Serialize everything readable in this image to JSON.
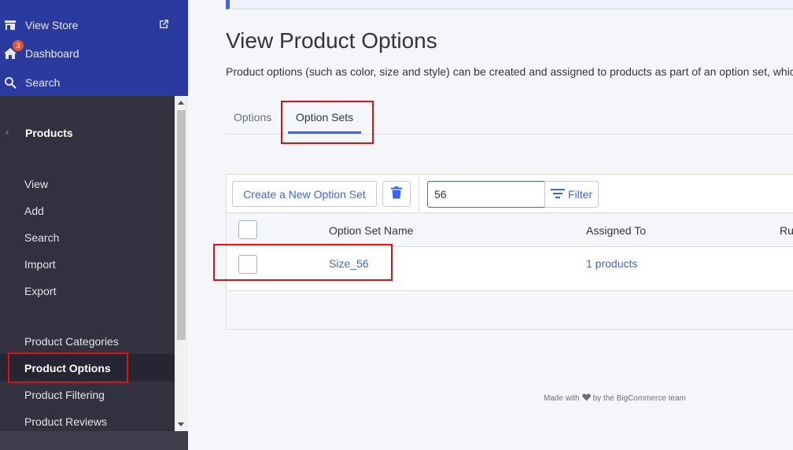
{
  "sidebar": {
    "top": {
      "view_store": "View Store",
      "dashboard": "Dashboard",
      "dashboard_badge": "3",
      "search": "Search"
    },
    "section_title": "Products",
    "items": [
      {
        "label": "View"
      },
      {
        "label": "Add"
      },
      {
        "label": "Search"
      },
      {
        "label": "Import"
      },
      {
        "label": "Export"
      },
      {
        "label": "Product Categories"
      },
      {
        "label": "Product Options"
      },
      {
        "label": "Product Filtering"
      },
      {
        "label": "Product Reviews"
      }
    ],
    "active_item": "Product Options"
  },
  "main": {
    "title": "View Product Options",
    "description": "Product options (such as color, size and style) can be created and assigned to products as part of an option set, whic",
    "tabs": [
      {
        "label": "Options"
      },
      {
        "label": "Option Sets"
      }
    ],
    "active_tab": "Option Sets",
    "toolbar": {
      "create_label": "Create a New Option Set",
      "search_value": "56",
      "filter_label": "Filter"
    },
    "table": {
      "columns": [
        "Option Set Name",
        "Assigned To",
        "Ru"
      ],
      "rows": [
        {
          "name": "Size_56",
          "assigned": "1 products"
        }
      ]
    },
    "footer": {
      "before": "Made with",
      "after": "by the BigCommerce team"
    }
  },
  "colors": {
    "accent": "#3c64f4",
    "sidebar_top": "#2a3a9e",
    "sidebar": "#323140",
    "highlight": "#e01010",
    "badge": "#e8572a"
  },
  "icons": [
    "store-icon",
    "external-link-icon",
    "home-icon",
    "search-icon",
    "chevron-left-icon",
    "trash-icon",
    "filter-icon",
    "heart-icon"
  ]
}
